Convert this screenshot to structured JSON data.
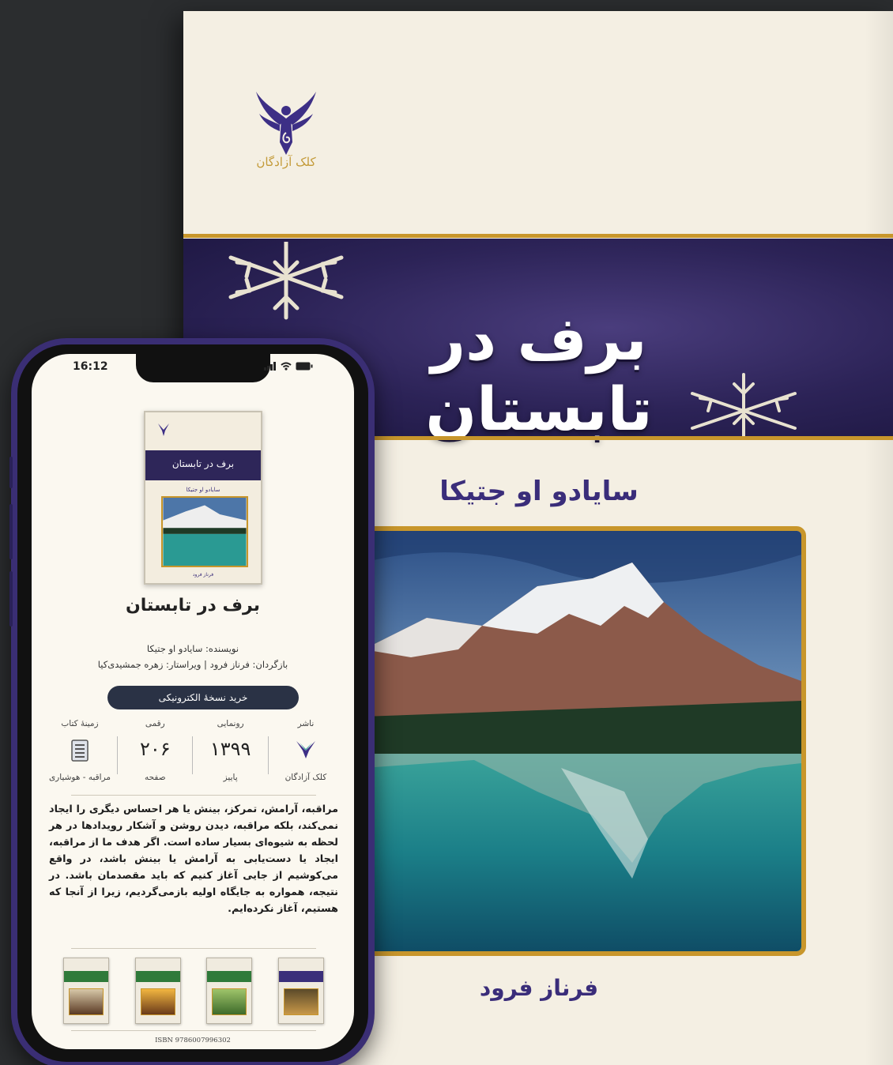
{
  "cover": {
    "publisher_name": "کلک آزادگان",
    "title": "برف در تابستان",
    "author": "سایادو او جتیکا",
    "translator": "فرناز فرود"
  },
  "phone": {
    "status_time": "16:12",
    "book_thumb": {
      "title": "برف در تابستان",
      "author": "سایادو او جتیکا",
      "translator": "فرناز فرود"
    },
    "title": "برف در تابستان",
    "author_line": "نویسنده: سایادو او جتیکا",
    "credits_line": "بازگردان: فرناز فرود | ویراستار: زهره جمشیدی‌کیا",
    "buy_button": "خرید نسخهٔ الکترونیکی",
    "stats": [
      {
        "label": "ناشر",
        "value": "",
        "sub": "کلک آزادگان",
        "icon": "publisher-logo-icon"
      },
      {
        "label": "رونمایی",
        "value": "۱۳۹۹",
        "sub": "پاییز"
      },
      {
        "label": "رقمی",
        "value": "۲۰۶",
        "sub": "صفحه"
      },
      {
        "label": "زمینهٔ کتاب",
        "value": "",
        "sub": "مراقبه - هوشیاری",
        "icon": "book-category-icon"
      }
    ],
    "description": "مراقبه، آرامش، تمرکز، بینش یا هر احساس دیگری را ایجاد نمی‌کند، بلکه مراقبه، دیدن روشن و آشکار رویدادها در هر لحظه به شیوه‌ای بسیار ساده است. اگر هدف ما از مراقبه، ایجاد یا دست‌یابی به آرامش یا بینش باشد، در واقع می‌کوشیم از جایی آغاز کنیم که باید مقصدمان باشد. در نتیجه، همواره به جایگاه اولیه بازمی‌گردیم، زیرا از آنجا که هستیم، آغاز نکرده‌ایم.",
    "related_books_count": 4,
    "isbn": "ISBN 9786007996302"
  },
  "colors": {
    "background": "#2b2d2f",
    "cover_cream": "#f4efe3",
    "banner_purple": "#2c2357",
    "gold": "#c8962b",
    "text_purple": "#3a2d7a",
    "phone_frame": "#3a2e74",
    "buy_button": "#2a3245"
  }
}
